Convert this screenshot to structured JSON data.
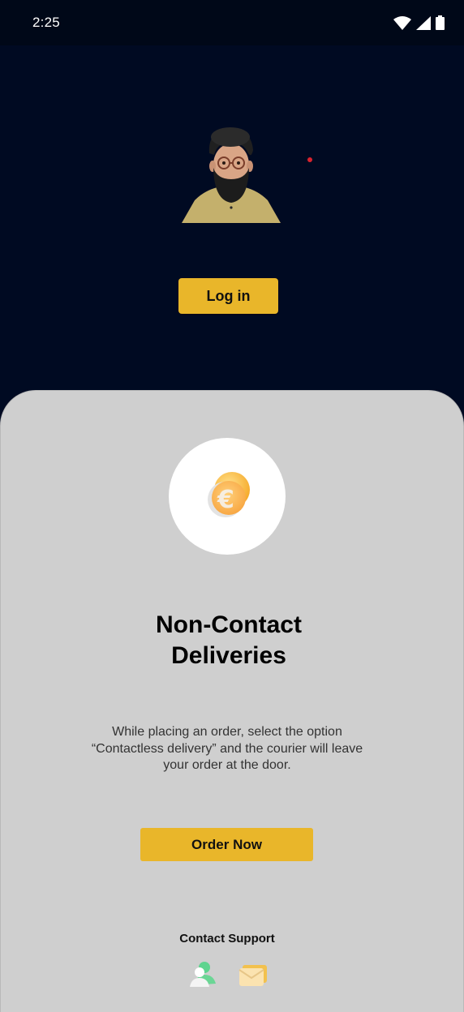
{
  "status_bar": {
    "time": "2:25",
    "icons": [
      "wifi-icon",
      "cellular-signal-icon",
      "battery-icon"
    ]
  },
  "header": {
    "avatar": "bearded-man-avatar",
    "login_label": "Log in"
  },
  "feature": {
    "icon": "euro-coin-icon",
    "title_line1": "Non-Contact",
    "title_line2": "Deliveries",
    "description_line1": "While placing an order, select the option",
    "description_line2": "“Contactless delivery” and the courier will leave",
    "description_line3": "your order at the door.",
    "cta_label": "Order Now"
  },
  "support": {
    "label": "Contact Support",
    "icons": [
      "person-support-icon",
      "mail-icon"
    ]
  },
  "colors": {
    "background_dark": "#000a22",
    "sheet": "#cfcfcf",
    "accent": "#e9b62a"
  }
}
